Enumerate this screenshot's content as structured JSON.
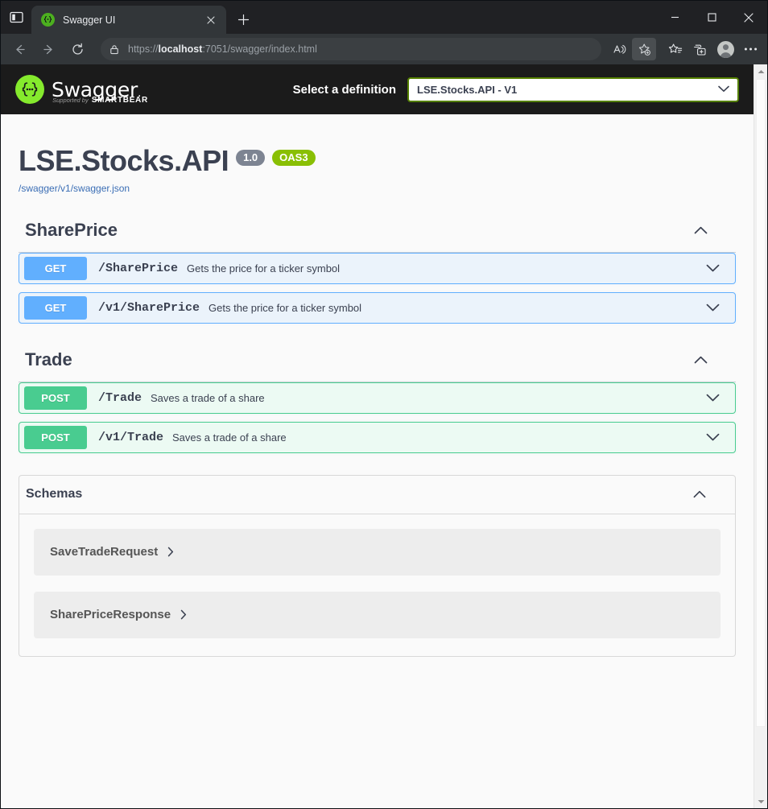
{
  "browser": {
    "tab": {
      "title": "Swagger UI",
      "favicon_icon": "swagger-favicon-icon",
      "close_icon": "close-icon"
    },
    "tab_search_icon": "tab-actions-icon",
    "new_tab_icon": "plus-icon",
    "window_controls": {
      "minimize_icon": "minimize-icon",
      "maximize_icon": "maximize-icon",
      "close_icon": "window-close-icon"
    },
    "toolbar": {
      "back_icon": "back-arrow-icon",
      "forward_icon": "forward-arrow-icon",
      "reload_icon": "reload-icon",
      "lock_icon": "lock-icon",
      "url_prefix": "https://",
      "url_host": "localhost",
      "url_suffix": ":7051/swagger/index.html",
      "url_full": "https://localhost:7051/swagger/index.html",
      "read_aloud_icon": "read-aloud-icon",
      "add_favorite_icon": "add-favorite-icon",
      "favorites_icon": "favorites-list-icon",
      "collections_icon": "collections-icon",
      "profile_icon": "profile-avatar-icon",
      "settings_icon": "more-options-icon"
    },
    "scrollbar": {
      "up_icon": "scroll-up-arrow-icon",
      "down_icon": "scroll-down-arrow-icon"
    }
  },
  "swagger": {
    "logo": {
      "mark_icon": "swagger-logo-icon",
      "wordmark": "Swagger",
      "supported_by": "Supported by",
      "brand": "SMARTBEAR"
    },
    "definition_selector": {
      "label": "Select a definition",
      "value": "LSE.Stocks.API - V1",
      "caret_icon": "chevron-down-icon",
      "border_color": "#547f00"
    },
    "info": {
      "title": "LSE.Stocks.API",
      "version_badge": "1.0",
      "oas_badge": "OAS3",
      "spec_url": "/swagger/v1/swagger.json"
    },
    "colors": {
      "get": "#61affe",
      "post": "#49cc90",
      "get_bg": "#ebf3fb",
      "post_bg": "#ecfaf3",
      "oas_badge": "#89bf04",
      "version_badge": "#7d8492",
      "text": "#3b4151"
    },
    "tags": [
      {
        "name": "SharePrice",
        "collapse_icon": "chevron-up-icon",
        "operations": [
          {
            "method": "GET",
            "method_class": "get",
            "path": "/SharePrice",
            "summary": "Gets the price for a ticker symbol",
            "expand_icon": "chevron-down-icon"
          },
          {
            "method": "GET",
            "method_class": "get",
            "path": "/v1/SharePrice",
            "summary": "Gets the price for a ticker symbol",
            "expand_icon": "chevron-down-icon"
          }
        ]
      },
      {
        "name": "Trade",
        "collapse_icon": "chevron-up-icon",
        "operations": [
          {
            "method": "POST",
            "method_class": "post",
            "path": "/Trade",
            "summary": "Saves a trade of a share",
            "expand_icon": "chevron-down-icon"
          },
          {
            "method": "POST",
            "method_class": "post",
            "path": "/v1/Trade",
            "summary": "Saves a trade of a share",
            "expand_icon": "chevron-down-icon"
          }
        ]
      }
    ],
    "schemas": {
      "title": "Schemas",
      "collapse_icon": "chevron-up-icon",
      "items": [
        {
          "name": "SaveTradeRequest",
          "caret_icon": "chevron-right-icon"
        },
        {
          "name": "SharePriceResponse",
          "caret_icon": "chevron-right-icon"
        }
      ]
    }
  }
}
